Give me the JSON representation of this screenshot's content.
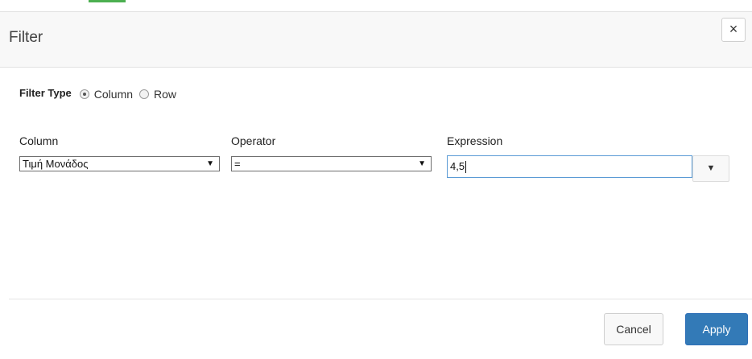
{
  "dialog": {
    "title": "Filter",
    "close_label": "×"
  },
  "filter_type": {
    "label": "Filter Type",
    "options": [
      {
        "label": "Column",
        "checked": true
      },
      {
        "label": "Row",
        "checked": false
      }
    ]
  },
  "column": {
    "label": "Column",
    "value": "Τιμή Μονάδος",
    "caret": "▼"
  },
  "operator": {
    "label": "Operator",
    "value": "=",
    "caret": "▼"
  },
  "expression": {
    "label": "Expression",
    "value": "4,5",
    "dropdown_caret": "▼"
  },
  "buttons": {
    "cancel": "Cancel",
    "apply": "Apply"
  },
  "colors": {
    "accent": "#337ab7",
    "focus_border": "#5b9bd5",
    "top_accent": "#4caf50"
  }
}
